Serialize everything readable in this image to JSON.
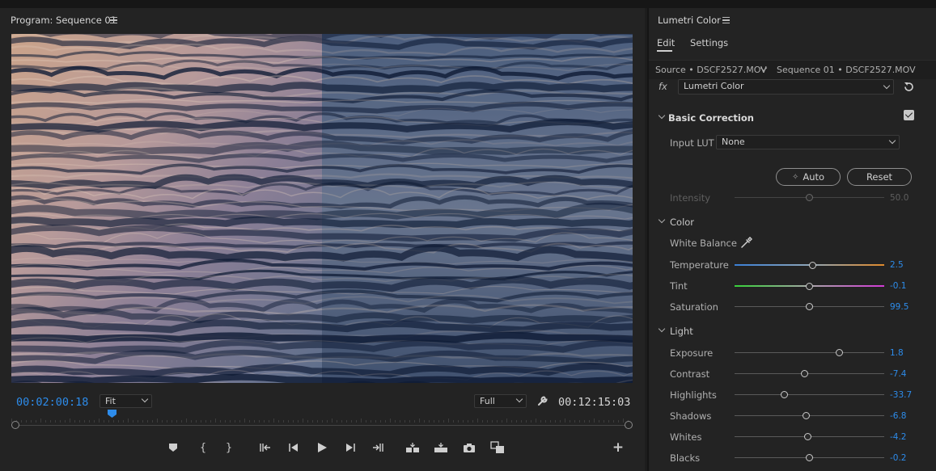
{
  "program_panel": {
    "title": "Program: Sequence 01",
    "timecode_current": "00:02:00:18",
    "timecode_duration": "00:12:15:03",
    "zoom_select": "Fit",
    "quality_select": "Full",
    "colors": {
      "accent": "#2d8ceb"
    }
  },
  "transport": {
    "buttons": [
      "add-marker",
      "mark-in",
      "mark-out",
      "go-to-in",
      "step-back",
      "play",
      "step-forward",
      "go-to-out",
      "insert",
      "overwrite",
      "export-frame",
      "comparison-view",
      "add-button"
    ]
  },
  "lumetri": {
    "title": "Lumetri Color",
    "tabs": [
      "Edit",
      "Settings"
    ],
    "source_label": "Source • DSCF2527.MOV",
    "sequence_label": "Sequence 01 • DSCF2527.MOV",
    "fx_label": "fx",
    "effect_select": "Lumetri Color",
    "basic_correction": {
      "title": "Basic Correction",
      "enabled": true,
      "input_lut_label": "Input LUT",
      "input_lut_value": "None",
      "auto_label": "Auto",
      "reset_label": "Reset",
      "intensity": {
        "label": "Intensity",
        "value": "50.0",
        "position": 0.5
      }
    },
    "color_section": {
      "title": "Color",
      "white_balance_label": "White Balance",
      "sliders": [
        {
          "label": "Temperature",
          "value": "2.5",
          "position": 0.52
        },
        {
          "label": "Tint",
          "value": "-0.1",
          "position": 0.5
        },
        {
          "label": "Saturation",
          "value": "99.5",
          "position": 0.5
        }
      ]
    },
    "light_section": {
      "title": "Light",
      "sliders": [
        {
          "label": "Exposure",
          "value": "1.8",
          "position": 0.7
        },
        {
          "label": "Contrast",
          "value": "-7.4",
          "position": 0.47
        },
        {
          "label": "Highlights",
          "value": "-33.7",
          "position": 0.33
        },
        {
          "label": "Shadows",
          "value": "-6.8",
          "position": 0.48
        },
        {
          "label": "Whites",
          "value": "-4.2",
          "position": 0.49
        },
        {
          "label": "Blacks",
          "value": "-0.2",
          "position": 0.5
        }
      ]
    }
  }
}
